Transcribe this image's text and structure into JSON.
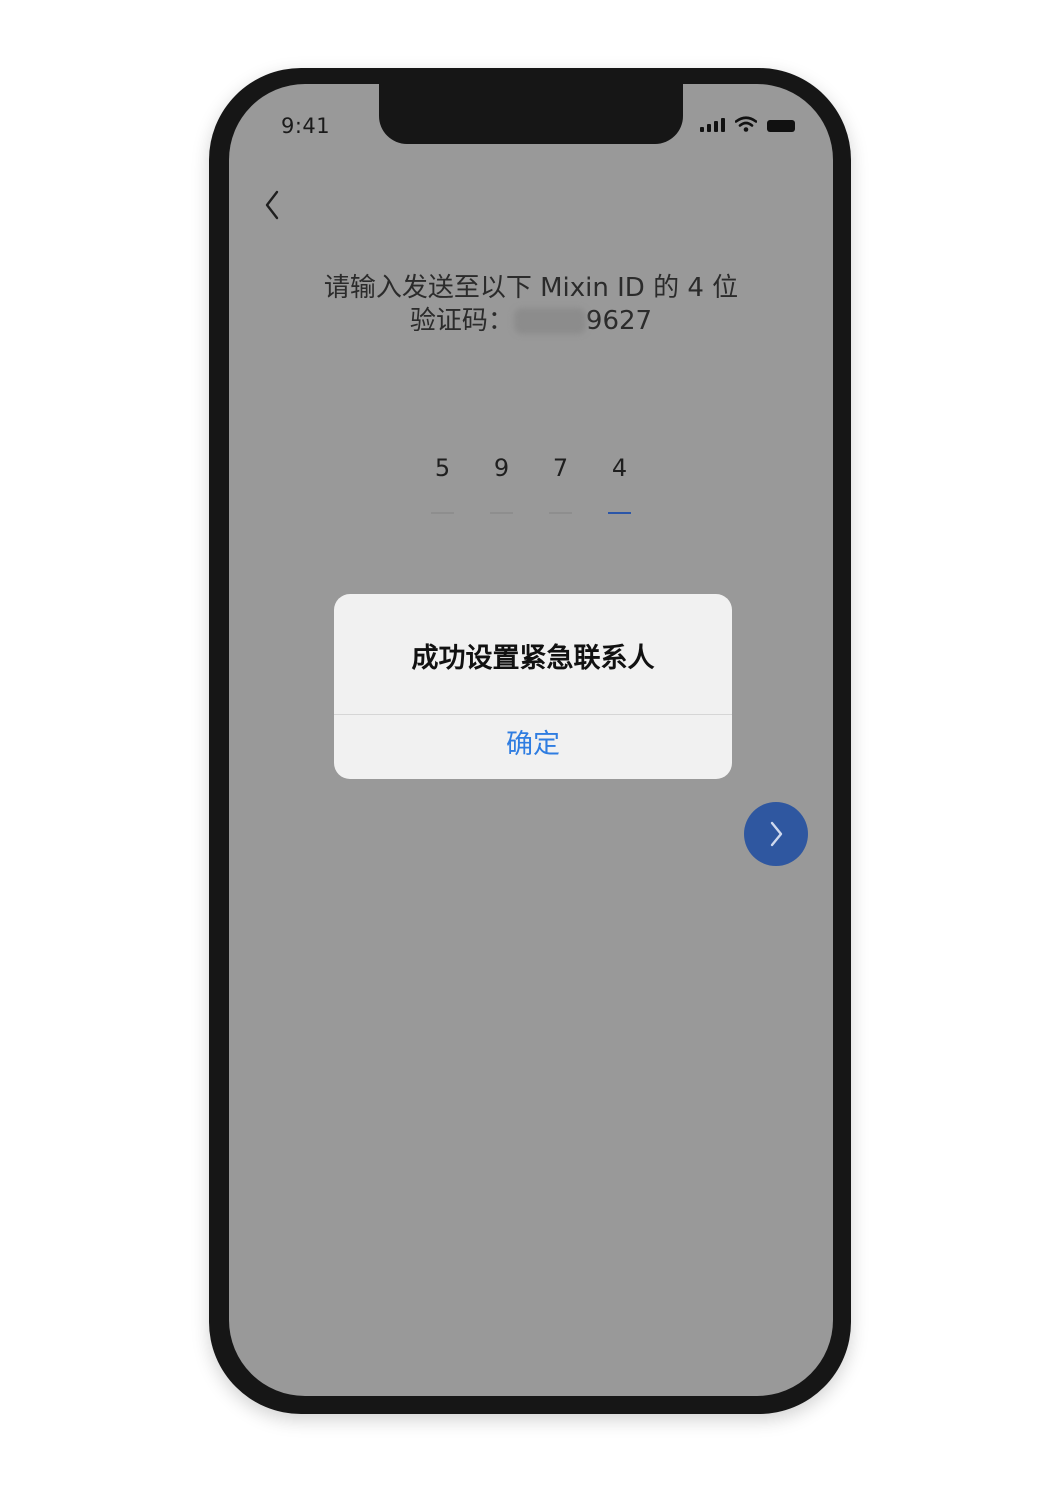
{
  "status_bar": {
    "time": "9:41",
    "icons": [
      "signal-icon",
      "wifi-icon",
      "battery-icon"
    ]
  },
  "header": {
    "back_icon": "chevron-left-icon"
  },
  "instruction": {
    "line1": "请输入发送至以下 Mixin ID 的 4 位",
    "line2_prefix": "验证码：",
    "line2_suffix": "9627"
  },
  "code_input": {
    "digits": [
      "5",
      "9",
      "7",
      "4"
    ],
    "active_index": 3
  },
  "alert": {
    "title": "成功设置紧急联系人",
    "confirm_label": "确定"
  },
  "next_button": {
    "icon": "chevron-right-icon",
    "color": "#2f57a0"
  },
  "colors": {
    "overlay_gray": "#999999",
    "accent_blue": "#2f7de1"
  }
}
